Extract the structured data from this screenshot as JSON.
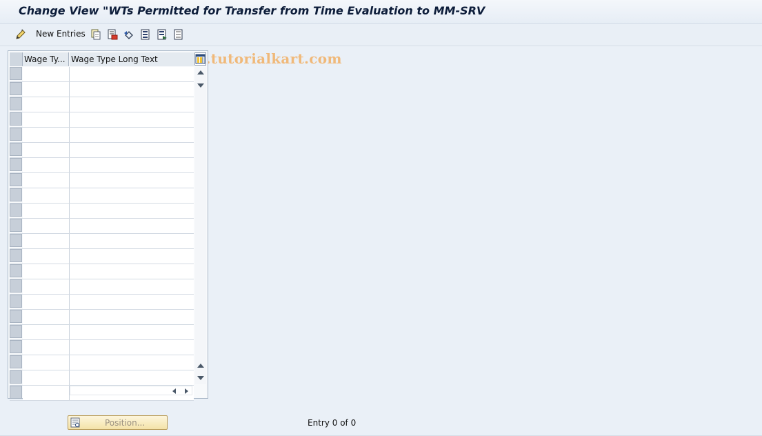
{
  "window": {
    "title": "Change View \"WTs Permitted for Transfer from Time Evaluation to MM-SRV"
  },
  "toolbar": {
    "new_entries_label": "New Entries",
    "icons": [
      "edit-pencil-icon",
      "copy-icon",
      "delete-icon",
      "undo-icon",
      "select-all-icon",
      "select-block-icon",
      "deselect-all-icon"
    ]
  },
  "watermark": {
    "text": "www.tutorialkart.com"
  },
  "table": {
    "columns": [
      "Wage Ty...",
      "Wage Type Long Text"
    ],
    "row_count": 22
  },
  "footer": {
    "position_label": "Position...",
    "entry_text": "Entry 0 of 0"
  },
  "colors": {
    "background": "#eaf0f7",
    "title_text": "#0d1d3a",
    "watermark": "#f0b97a",
    "button": "#f4e2a8"
  }
}
